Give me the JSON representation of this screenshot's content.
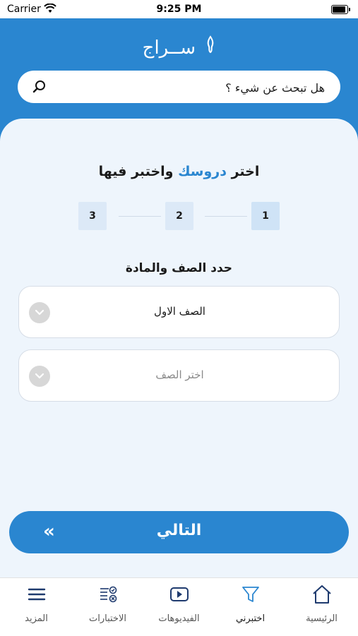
{
  "status_bar": {
    "carrier": "Carrier",
    "time": "9:25 PM"
  },
  "header": {
    "logo_text": "ســراج",
    "search_placeholder": "هل تبحث عن شيء ؟"
  },
  "main": {
    "title_part1": "اختر ",
    "title_accent": "دروسك",
    "title_part2": " واختبر فيها",
    "steps": [
      "1",
      "2",
      "3"
    ],
    "section_title": "حدد الصف والمادة",
    "grade_select_value": "الصف الاول",
    "second_select_placeholder": "اختر الصف",
    "next_label": "التالي",
    "next_arrows": "«"
  },
  "tabs": [
    {
      "label": "الرئيسية",
      "icon": "home-icon"
    },
    {
      "label": "اختبرني",
      "icon": "filter-icon",
      "active": true
    },
    {
      "label": "الفيديوهات",
      "icon": "video-icon"
    },
    {
      "label": "الاختبارات",
      "icon": "quiz-list-icon"
    },
    {
      "label": "المزيد",
      "icon": "menu-icon"
    }
  ],
  "colors": {
    "primary": "#2a86d0",
    "step_bg": "#dce9f7",
    "panel_bg": "#eef5fc",
    "nav_icon": "#1e3a6e"
  }
}
